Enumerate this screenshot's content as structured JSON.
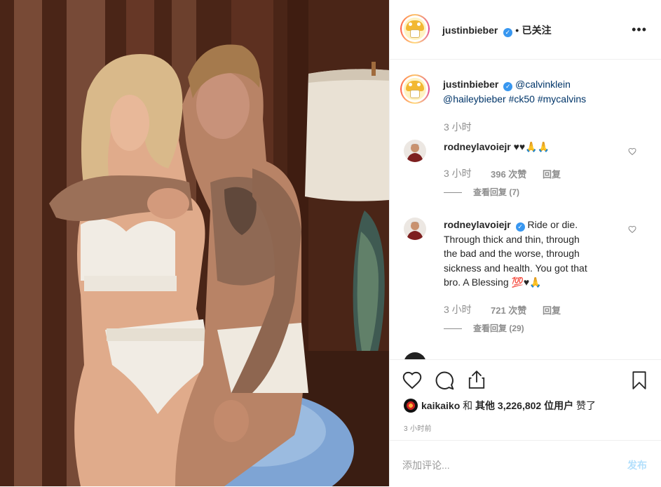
{
  "post": {
    "author": "justinbieber",
    "follow_separator": "•",
    "follow_status": "已关注",
    "more_icon": "more-options-icon"
  },
  "caption": {
    "username": "justinbieber",
    "mention1": "@calvinklein",
    "mention2": "@haileybieber",
    "tag1": "#ck50",
    "tag2": "#mycalvins",
    "time": "3 小时"
  },
  "comments": [
    {
      "username": "rodneylavoiejr",
      "text": "♥♥🙏🙏",
      "time": "3 小时",
      "likes": "396 次赞",
      "reply": "回复",
      "view_replies": "查看回复 (7)"
    },
    {
      "username": "rodneylavoiejr",
      "text_lines": [
        "Ride or die.",
        "Through thick and thin, through",
        "the bad and the worse, through",
        "sickness and health. You got that",
        "bro. A Blessing 💯♥🙏"
      ],
      "time": "3 小时",
      "likes": "721 次赞",
      "reply": "回复",
      "view_replies": "查看回复 (29)"
    }
  ],
  "likes_summary": {
    "user": "kaikaiko",
    "connector": "和",
    "others": "其他 3,226,802 位用户",
    "suffix": "赞了"
  },
  "timestamp": "3 小时前",
  "add_comment": {
    "placeholder": "添加评论...",
    "post_label": "发布"
  },
  "colors": {
    "verified": "#3897f0",
    "link": "#003569",
    "muted": "#8e8e8e",
    "post_disabled": "#b2dffc"
  }
}
